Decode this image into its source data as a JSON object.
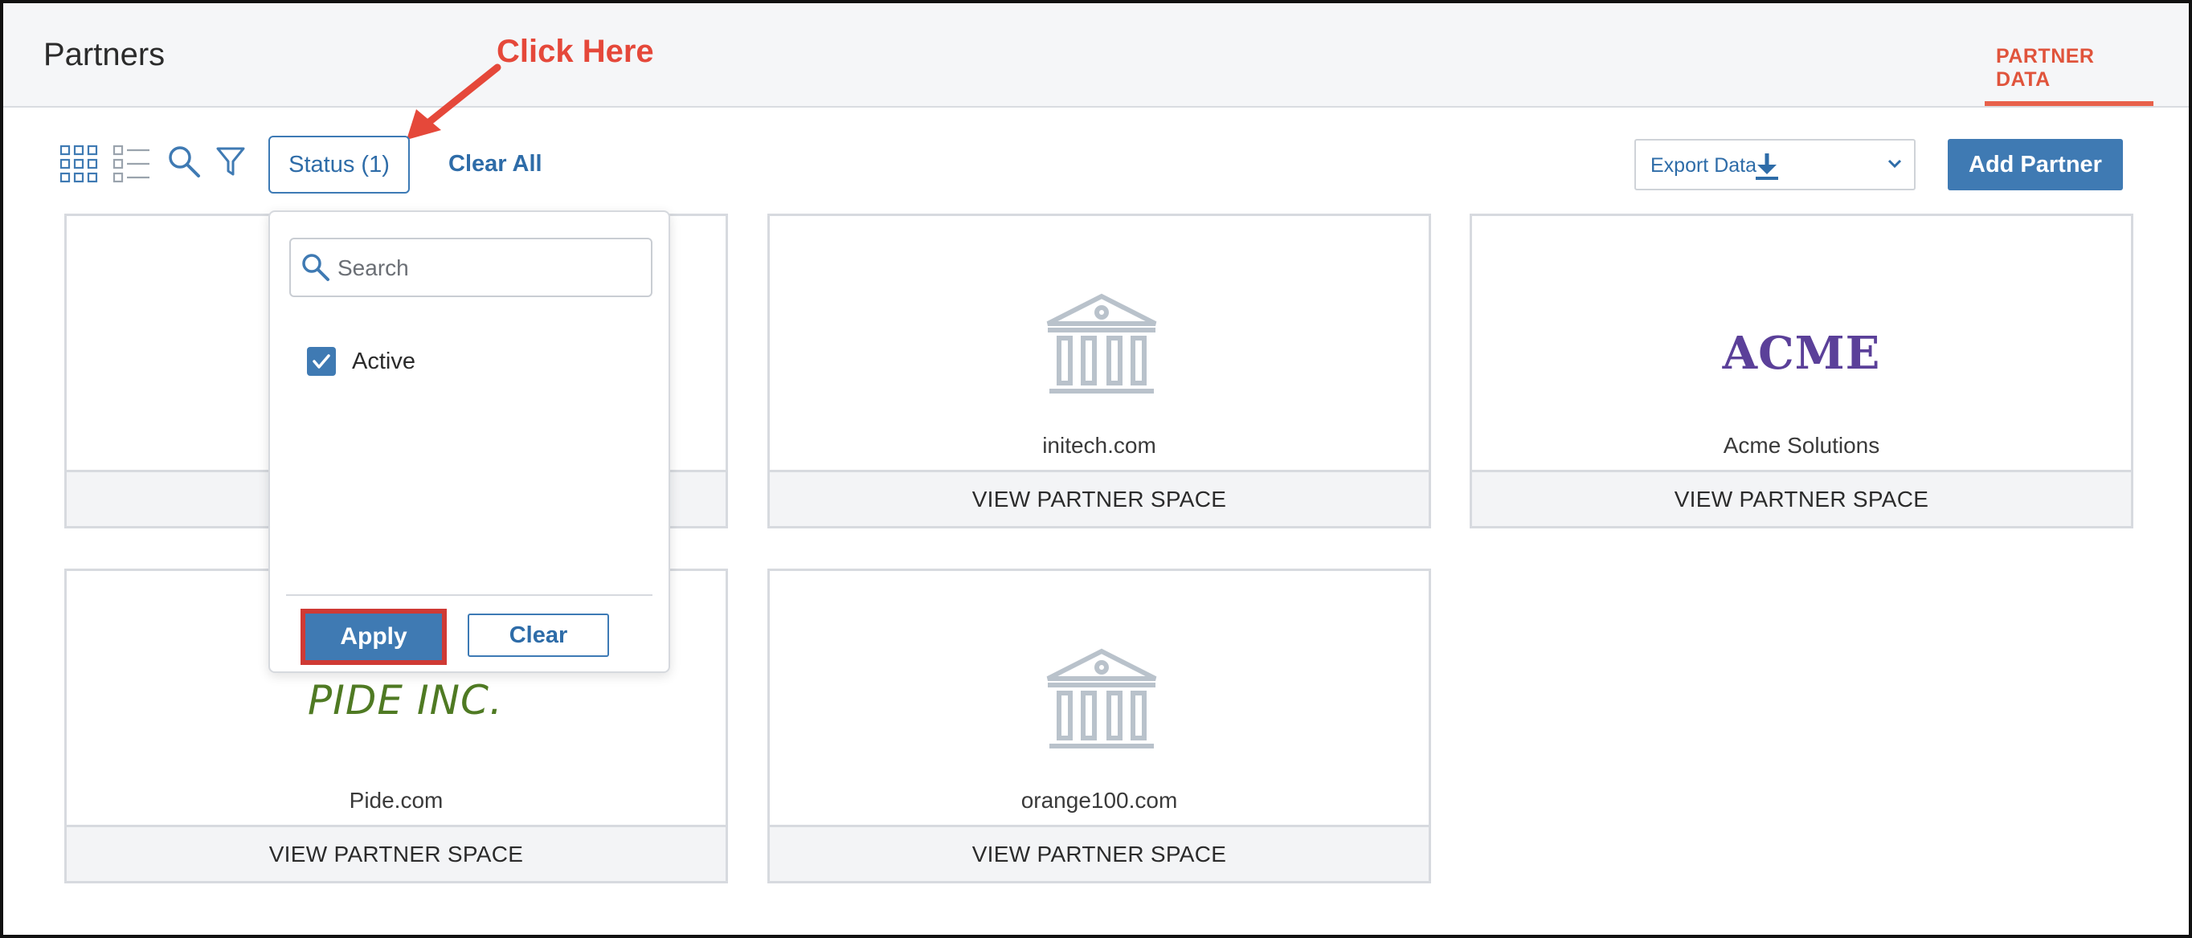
{
  "header": {
    "title": "Partners",
    "tab_label": "PARTNER DATA",
    "accent_color": "#e0543c"
  },
  "annotation": {
    "text": "Click Here",
    "color": "#e5483a"
  },
  "toolbar": {
    "icons": [
      "grid-view-icon",
      "list-view-icon",
      "search-icon",
      "filter-icon"
    ],
    "status_filter_label": "Status (1)",
    "clear_all_label": "Clear All",
    "export_label": "Export Data",
    "export_icon": "download-icon",
    "add_partner_label": "Add Partner",
    "primary_color": "#3f7ab3"
  },
  "status_dropdown": {
    "search_placeholder": "Search",
    "options": [
      {
        "label": "Active",
        "checked": true
      }
    ],
    "apply_label": "Apply",
    "clear_label": "Clear",
    "highlight_color": "#cf3a35"
  },
  "partners": [
    {
      "name": "",
      "logo": "",
      "footer": "VIEW PARTNER SPACE"
    },
    {
      "name": "initech.com",
      "logo": "bank-icon",
      "footer": "VIEW PARTNER SPACE"
    },
    {
      "name": "Acme Solutions",
      "logo": "ACME",
      "footer": "VIEW PARTNER SPACE"
    },
    {
      "name": "Pide.com",
      "logo": "PIDE INC.",
      "footer": "VIEW PARTNER SPACE"
    },
    {
      "name": "orange100.com",
      "logo": "bank-icon",
      "footer": "VIEW PARTNER SPACE"
    }
  ]
}
